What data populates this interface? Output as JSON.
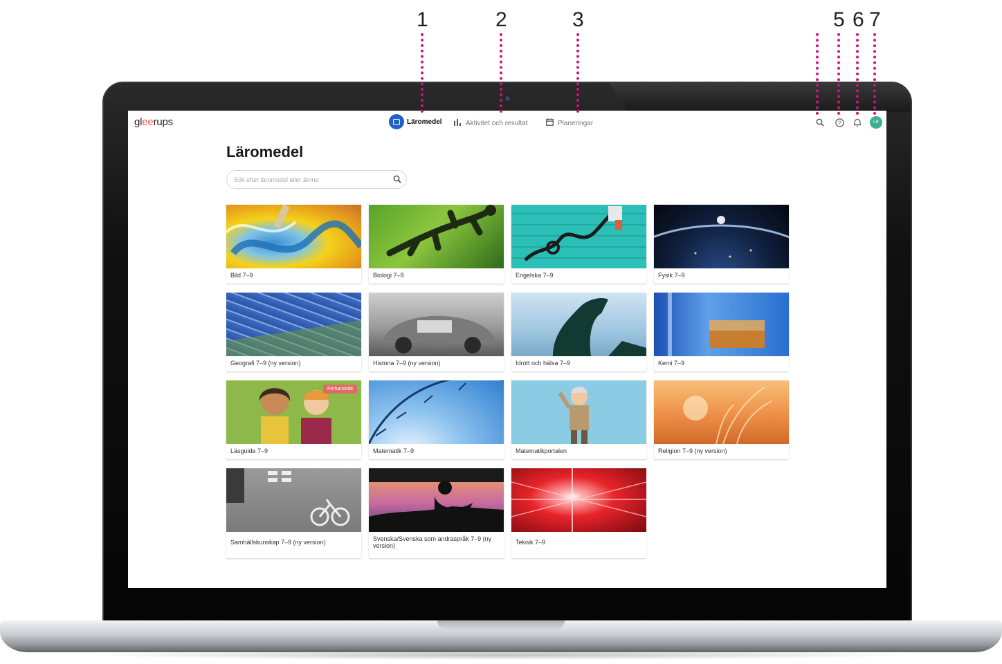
{
  "callouts": [
    "1",
    "2",
    "3",
    "5",
    "6",
    "7"
  ],
  "app": {
    "logo": {
      "pre": "gl",
      "accent": "ee",
      "post": "rups"
    },
    "nav": [
      {
        "label": "Läromedel",
        "icon": "book-icon",
        "active": true
      },
      {
        "label": "Aktivitet och resultat",
        "icon": "bar-chart-icon",
        "active": false
      },
      {
        "label": "Planeringar",
        "icon": "calendar-icon",
        "active": false
      }
    ],
    "right_icons": [
      "search-icon",
      "help-icon",
      "bell-icon"
    ],
    "avatar_initials": "LR",
    "accent_color": "#1e63c3",
    "avatar_color": "#3bb08f"
  },
  "page": {
    "title": "Läromedel",
    "search_placeholder": "Sök efter läromedel eller ämne"
  },
  "courses": [
    {
      "label": "Bild 7–9"
    },
    {
      "label": "Biologi 7–9"
    },
    {
      "label": "Engelska 7–9"
    },
    {
      "label": "Fysik 7–9"
    },
    {
      "label": "Geografi 7–9 (ny version)"
    },
    {
      "label": "Historia 7–9 (ny version)"
    },
    {
      "label": "Idrott och hälsa 7–9"
    },
    {
      "label": "Kemi 7–9"
    },
    {
      "label": "Läsguide 7–9",
      "badge": "Förhandstitt"
    },
    {
      "label": "Matematik 7–9"
    },
    {
      "label": "Matematikportalen"
    },
    {
      "label": "Religion 7–9 (ny version)"
    },
    {
      "label": "Samhällskunskap 7–9 (ny version)"
    },
    {
      "label": "Svenska/Svenska som andraspråk 7–9 (ny version)"
    },
    {
      "label": "Teknik 7–9"
    }
  ]
}
